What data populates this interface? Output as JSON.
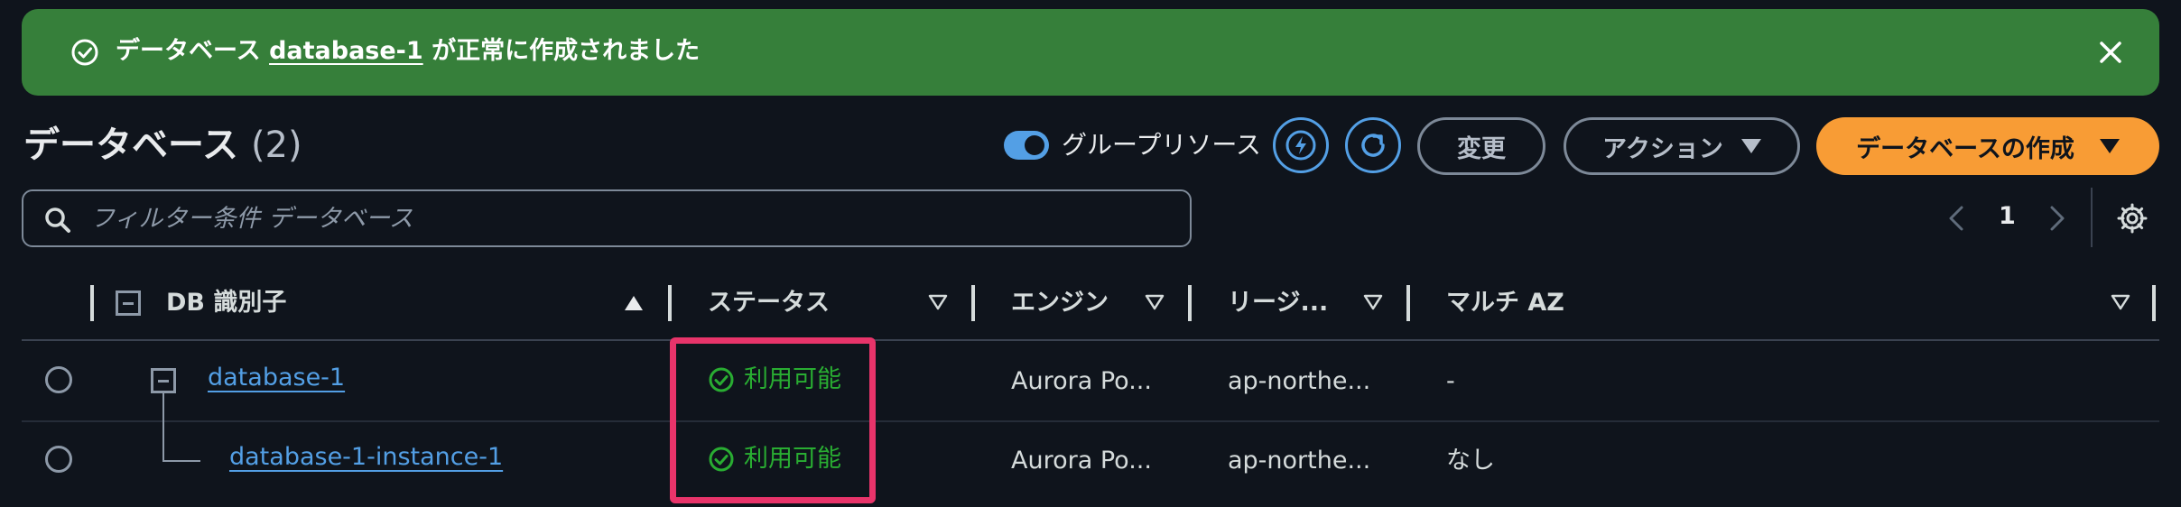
{
  "flash": {
    "prefix": "データベース ",
    "db_name": "database-1",
    "suffix": " が正常に作成されました"
  },
  "header": {
    "title": "データベース",
    "count": "(2)",
    "group_resources_label": "グループリソース",
    "group_resources_on": true,
    "modify_label": "変更",
    "actions_label": "アクション",
    "create_label": "データベースの作成"
  },
  "filter": {
    "placeholder": "フィルター条件 データベース",
    "value": ""
  },
  "pagination": {
    "page": "1"
  },
  "table": {
    "columns": [
      "DB 識別子",
      "ステータス",
      "エンジン",
      "リージ...",
      "マルチ AZ"
    ],
    "rows": [
      {
        "id": "database-1",
        "status": "利用可能",
        "engine": "Aurora Po...",
        "region": "ap-northe...",
        "multi_az": "-"
      },
      {
        "id": "database-1-instance-1",
        "status": "利用可能",
        "engine": "Aurora Po...",
        "region": "ap-northe...",
        "multi_az": "なし"
      }
    ]
  },
  "colors": {
    "flash_bg": "#367f3a",
    "accent_blue": "#539fe5",
    "primary_orange": "#f89c35",
    "status_green": "#29ad32",
    "highlight": "#e8346a"
  },
  "icons": {
    "flash": "check-circle-icon",
    "close": "close-icon",
    "lightning": "lightning-icon",
    "refresh": "refresh-icon",
    "search": "search-icon",
    "settings": "gear-icon"
  }
}
